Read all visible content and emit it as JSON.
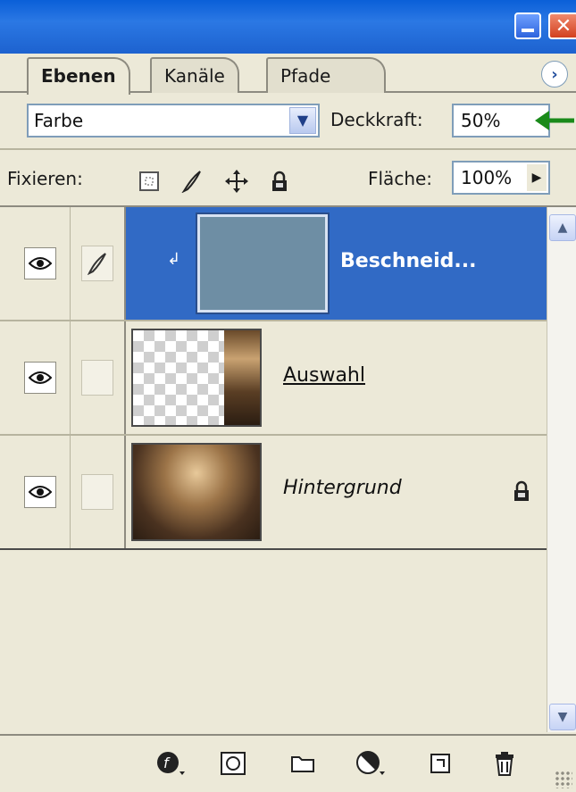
{
  "window": {
    "minimize_icon": "minimize-icon",
    "close_icon": "close-icon",
    "close_glyph": "✕"
  },
  "tabs": [
    {
      "label": "Ebenen",
      "active": true
    },
    {
      "label": "Kanäle",
      "active": false
    },
    {
      "label": "Pfade",
      "active": false
    }
  ],
  "panel_menu_glyph": "›",
  "blend": {
    "mode_value": "Farbe",
    "opacity_label": "Deckkraft:",
    "opacity_value": "50%"
  },
  "lock": {
    "label": "Fixieren:",
    "icons": [
      "lock-transparent-icon",
      "lock-image-icon",
      "lock-position-icon",
      "lock-all-icon"
    ],
    "fill_label": "Fläche:",
    "fill_value": "100%"
  },
  "layers": [
    {
      "name": "Beschneid...",
      "selected": true,
      "visible": true,
      "linked_icon": "brush-icon",
      "thumb": "solid-steel-blue",
      "clipping": true
    },
    {
      "name": "Auswahl",
      "selected": false,
      "visible": true,
      "thumb": "transparent-with-photo-strip",
      "underline": true
    },
    {
      "name": "Hintergrund",
      "selected": false,
      "visible": true,
      "thumb": "gallery-photo",
      "italic": true,
      "locked": true
    }
  ],
  "bottom_toolbar": {
    "icons": [
      "layer-style-icon",
      "layer-mask-icon",
      "new-group-icon",
      "adjustment-layer-icon",
      "new-layer-icon",
      "delete-layer-icon"
    ]
  },
  "colors": {
    "selection": "#316ac5",
    "panel_bg": "#ece9d8",
    "annotation_arrow": "#1a8a1a"
  }
}
